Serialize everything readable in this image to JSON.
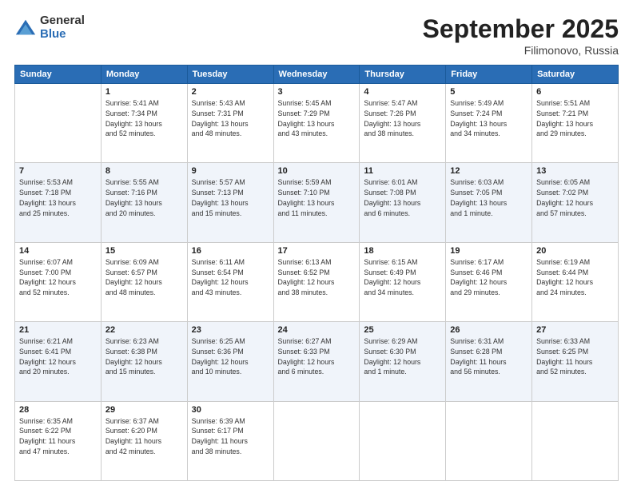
{
  "logo": {
    "general": "General",
    "blue": "Blue"
  },
  "title": "September 2025",
  "location": "Filimonovo, Russia",
  "days_of_week": [
    "Sunday",
    "Monday",
    "Tuesday",
    "Wednesday",
    "Thursday",
    "Friday",
    "Saturday"
  ],
  "weeks": [
    {
      "days": [
        {
          "num": "",
          "info": ""
        },
        {
          "num": "1",
          "info": "Sunrise: 5:41 AM\nSunset: 7:34 PM\nDaylight: 13 hours\nand 52 minutes."
        },
        {
          "num": "2",
          "info": "Sunrise: 5:43 AM\nSunset: 7:31 PM\nDaylight: 13 hours\nand 48 minutes."
        },
        {
          "num": "3",
          "info": "Sunrise: 5:45 AM\nSunset: 7:29 PM\nDaylight: 13 hours\nand 43 minutes."
        },
        {
          "num": "4",
          "info": "Sunrise: 5:47 AM\nSunset: 7:26 PM\nDaylight: 13 hours\nand 38 minutes."
        },
        {
          "num": "5",
          "info": "Sunrise: 5:49 AM\nSunset: 7:24 PM\nDaylight: 13 hours\nand 34 minutes."
        },
        {
          "num": "6",
          "info": "Sunrise: 5:51 AM\nSunset: 7:21 PM\nDaylight: 13 hours\nand 29 minutes."
        }
      ]
    },
    {
      "days": [
        {
          "num": "7",
          "info": "Sunrise: 5:53 AM\nSunset: 7:18 PM\nDaylight: 13 hours\nand 25 minutes."
        },
        {
          "num": "8",
          "info": "Sunrise: 5:55 AM\nSunset: 7:16 PM\nDaylight: 13 hours\nand 20 minutes."
        },
        {
          "num": "9",
          "info": "Sunrise: 5:57 AM\nSunset: 7:13 PM\nDaylight: 13 hours\nand 15 minutes."
        },
        {
          "num": "10",
          "info": "Sunrise: 5:59 AM\nSunset: 7:10 PM\nDaylight: 13 hours\nand 11 minutes."
        },
        {
          "num": "11",
          "info": "Sunrise: 6:01 AM\nSunset: 7:08 PM\nDaylight: 13 hours\nand 6 minutes."
        },
        {
          "num": "12",
          "info": "Sunrise: 6:03 AM\nSunset: 7:05 PM\nDaylight: 13 hours\nand 1 minute."
        },
        {
          "num": "13",
          "info": "Sunrise: 6:05 AM\nSunset: 7:02 PM\nDaylight: 12 hours\nand 57 minutes."
        }
      ]
    },
    {
      "days": [
        {
          "num": "14",
          "info": "Sunrise: 6:07 AM\nSunset: 7:00 PM\nDaylight: 12 hours\nand 52 minutes."
        },
        {
          "num": "15",
          "info": "Sunrise: 6:09 AM\nSunset: 6:57 PM\nDaylight: 12 hours\nand 48 minutes."
        },
        {
          "num": "16",
          "info": "Sunrise: 6:11 AM\nSunset: 6:54 PM\nDaylight: 12 hours\nand 43 minutes."
        },
        {
          "num": "17",
          "info": "Sunrise: 6:13 AM\nSunset: 6:52 PM\nDaylight: 12 hours\nand 38 minutes."
        },
        {
          "num": "18",
          "info": "Sunrise: 6:15 AM\nSunset: 6:49 PM\nDaylight: 12 hours\nand 34 minutes."
        },
        {
          "num": "19",
          "info": "Sunrise: 6:17 AM\nSunset: 6:46 PM\nDaylight: 12 hours\nand 29 minutes."
        },
        {
          "num": "20",
          "info": "Sunrise: 6:19 AM\nSunset: 6:44 PM\nDaylight: 12 hours\nand 24 minutes."
        }
      ]
    },
    {
      "days": [
        {
          "num": "21",
          "info": "Sunrise: 6:21 AM\nSunset: 6:41 PM\nDaylight: 12 hours\nand 20 minutes."
        },
        {
          "num": "22",
          "info": "Sunrise: 6:23 AM\nSunset: 6:38 PM\nDaylight: 12 hours\nand 15 minutes."
        },
        {
          "num": "23",
          "info": "Sunrise: 6:25 AM\nSunset: 6:36 PM\nDaylight: 12 hours\nand 10 minutes."
        },
        {
          "num": "24",
          "info": "Sunrise: 6:27 AM\nSunset: 6:33 PM\nDaylight: 12 hours\nand 6 minutes."
        },
        {
          "num": "25",
          "info": "Sunrise: 6:29 AM\nSunset: 6:30 PM\nDaylight: 12 hours\nand 1 minute."
        },
        {
          "num": "26",
          "info": "Sunrise: 6:31 AM\nSunset: 6:28 PM\nDaylight: 11 hours\nand 56 minutes."
        },
        {
          "num": "27",
          "info": "Sunrise: 6:33 AM\nSunset: 6:25 PM\nDaylight: 11 hours\nand 52 minutes."
        }
      ]
    },
    {
      "days": [
        {
          "num": "28",
          "info": "Sunrise: 6:35 AM\nSunset: 6:22 PM\nDaylight: 11 hours\nand 47 minutes."
        },
        {
          "num": "29",
          "info": "Sunrise: 6:37 AM\nSunset: 6:20 PM\nDaylight: 11 hours\nand 42 minutes."
        },
        {
          "num": "30",
          "info": "Sunrise: 6:39 AM\nSunset: 6:17 PM\nDaylight: 11 hours\nand 38 minutes."
        },
        {
          "num": "",
          "info": ""
        },
        {
          "num": "",
          "info": ""
        },
        {
          "num": "",
          "info": ""
        },
        {
          "num": "",
          "info": ""
        }
      ]
    }
  ]
}
